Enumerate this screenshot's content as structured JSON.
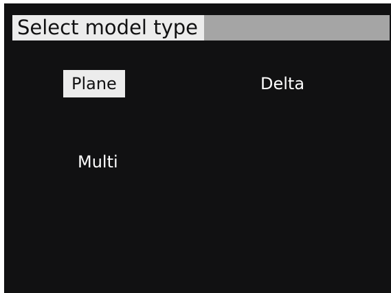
{
  "screen": {
    "title": "Select model type"
  },
  "model_types": [
    {
      "label": "Plane",
      "selected": true
    },
    {
      "label": "Delta",
      "selected": false
    },
    {
      "label": "Multi",
      "selected": false
    }
  ],
  "colors": {
    "background": "#111112",
    "title_bar_fill": "#a5a5a5",
    "highlight": "#ececec",
    "text_light": "#ffffff",
    "text_dark": "#111112"
  }
}
